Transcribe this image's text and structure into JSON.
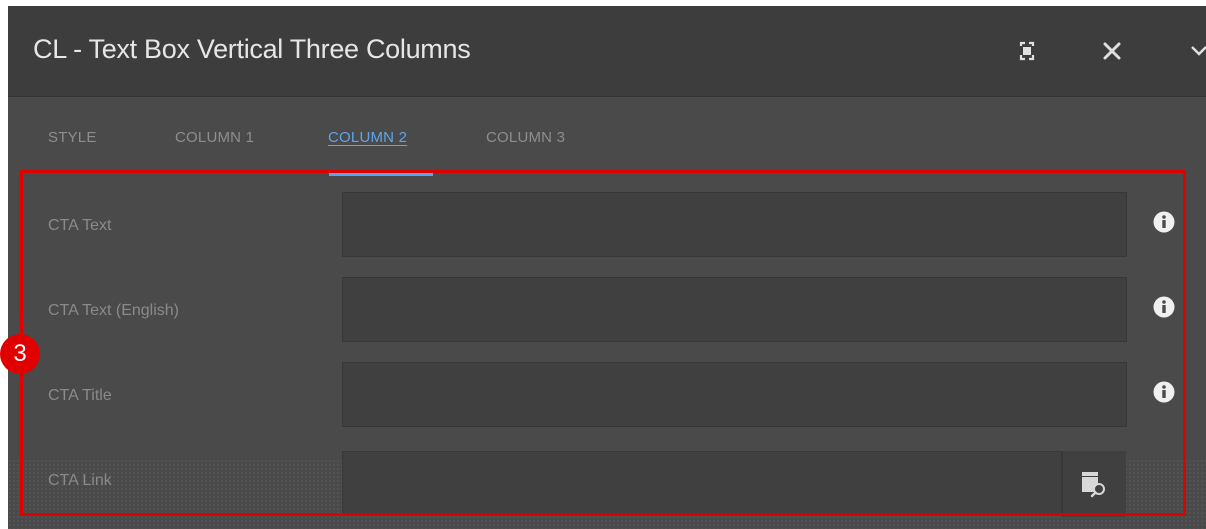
{
  "dialog": {
    "title": "CL - Text Box Vertical Three Columns"
  },
  "toolbar": {
    "icons": [
      "fullscreen-icon",
      "close-icon",
      "chevron-down-icon"
    ]
  },
  "tabs": [
    {
      "label": "STYLE",
      "active": false
    },
    {
      "label": "COLUMN 1",
      "active": false
    },
    {
      "label": "COLUMN 2",
      "active": true
    },
    {
      "label": "COLUMN 3",
      "active": false
    }
  ],
  "fields": [
    {
      "label": "CTA Text",
      "value": "",
      "icon": "info-icon"
    },
    {
      "label": "CTA Text (English)",
      "value": "",
      "icon": "info-icon"
    },
    {
      "label": "CTA Title",
      "value": "",
      "icon": "info-icon"
    },
    {
      "label": "CTA Link",
      "value": "",
      "icon": "browse-path-icon"
    }
  ],
  "annotation": {
    "step": "3",
    "color": "#e10000"
  },
  "colors": {
    "accent": "#5ea4ec",
    "titlebar": "#3d3d3d",
    "panel": "#4a4a4a"
  }
}
